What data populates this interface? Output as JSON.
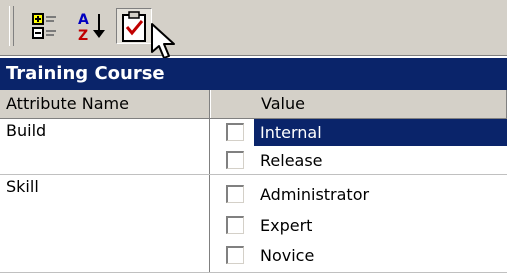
{
  "toolbar": {
    "buttons": [
      {
        "name": "categorized-icon"
      },
      {
        "name": "sort-alphabetical-icon"
      },
      {
        "name": "property-pages-icon",
        "pressed": true
      }
    ]
  },
  "category": {
    "title": "Training Course"
  },
  "columns": {
    "attribute": "Attribute Name",
    "value": "Value"
  },
  "attributes": [
    {
      "name": "Build"
    },
    {
      "name": "Skill"
    }
  ],
  "values": [
    {
      "label": "Internal",
      "checked": false,
      "selected": true
    },
    {
      "label": "Release",
      "checked": false,
      "selected": false
    },
    {
      "label": "Administrator",
      "checked": false,
      "selected": false
    },
    {
      "label": "Expert",
      "checked": false,
      "selected": false
    },
    {
      "label": "Novice",
      "checked": false,
      "selected": false
    }
  ],
  "colors": {
    "selection": "#0a246a",
    "toolbar": "#d4d0c8"
  }
}
